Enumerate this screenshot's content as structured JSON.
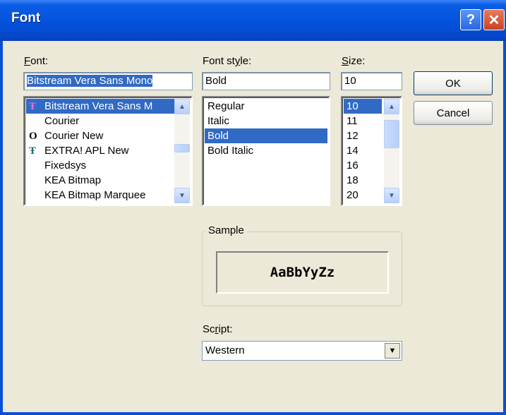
{
  "window": {
    "title": "Font",
    "help_glyph": "?",
    "close_glyph": "✕"
  },
  "font": {
    "label": "Font:",
    "label_ul": "F",
    "label_rest": "ont:",
    "value": "Bitstream Vera Sans Mono",
    "items": [
      {
        "icon": "truetype-icon",
        "icon_glyph": "Ŧ",
        "label": "Bitstream Vera Sans M",
        "selected": true
      },
      {
        "icon": "",
        "icon_glyph": "",
        "label": "Courier",
        "selected": false
      },
      {
        "icon": "opentype-icon",
        "icon_glyph": "O",
        "label": "Courier New",
        "selected": false
      },
      {
        "icon": "truetype-icon",
        "icon_glyph": "Ŧ",
        "label": "EXTRA! APL New",
        "selected": false
      },
      {
        "icon": "",
        "icon_glyph": "",
        "label": "Fixedsys",
        "selected": false
      },
      {
        "icon": "",
        "icon_glyph": "",
        "label": "KEA Bitmap",
        "selected": false
      },
      {
        "icon": "",
        "icon_glyph": "",
        "label": "KEA Bitmap Marquee",
        "selected": false
      }
    ]
  },
  "style": {
    "label_pre": "Font st",
    "label_ul": "y",
    "label_rest": "le:",
    "value": "Bold",
    "items": [
      {
        "label": "Regular",
        "selected": false
      },
      {
        "label": "Italic",
        "selected": false
      },
      {
        "label": "Bold",
        "selected": true
      },
      {
        "label": "Bold Italic",
        "selected": false
      }
    ]
  },
  "size": {
    "label_ul": "S",
    "label_rest": "ize:",
    "value": "10",
    "items": [
      {
        "label": "10",
        "selected": true
      },
      {
        "label": "11",
        "selected": false
      },
      {
        "label": "12",
        "selected": false
      },
      {
        "label": "14",
        "selected": false
      },
      {
        "label": "16",
        "selected": false
      },
      {
        "label": "18",
        "selected": false
      },
      {
        "label": "20",
        "selected": false
      }
    ]
  },
  "buttons": {
    "ok": "OK",
    "cancel": "Cancel"
  },
  "sample": {
    "label": "Sample",
    "text": "AaBbYyZz"
  },
  "script": {
    "label_pre": "Sc",
    "label_ul": "r",
    "label_rest": "ipt:",
    "value": "Western"
  },
  "colors": {
    "title_bar": "#0452DB",
    "selection": "#316AC5",
    "dialog_bg": "#ECE9D8"
  }
}
